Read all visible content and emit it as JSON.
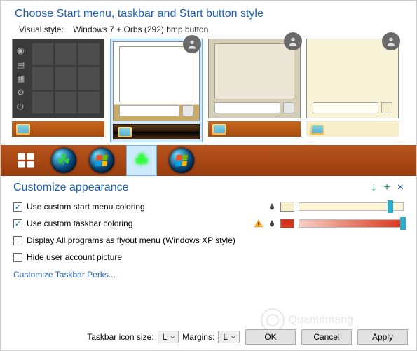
{
  "header": {
    "title": "Choose Start menu, taskbar and Start button style"
  },
  "visualStyle": {
    "label": "Visual style:",
    "value": "Windows 7 + Orbs (292).bmp button"
  },
  "thumbs": [
    {
      "name": "win8-style",
      "selected": false,
      "hasAvatar": false
    },
    {
      "name": "win7-style",
      "selected": true,
      "hasAvatar": true
    },
    {
      "name": "flatglass-style",
      "selected": false,
      "hasAvatar": true
    },
    {
      "name": "plain-light-style",
      "selected": false,
      "hasAvatar": true
    }
  ],
  "orbs": [
    {
      "name": "flat-windows-orb",
      "selected": false
    },
    {
      "name": "clover-blue-orb",
      "selected": false
    },
    {
      "name": "win7-default-orb",
      "selected": false
    },
    {
      "name": "neon-clover-orb",
      "selected": true
    },
    {
      "name": "win-flag-glass-orb",
      "selected": false
    }
  ],
  "customize": {
    "title": "Customize appearance",
    "actions": {
      "download": "↓",
      "add": "+",
      "close": "×"
    },
    "options": {
      "useStartMenuColoring": {
        "label": "Use custom start menu coloring",
        "checked": true,
        "swatch": "#f8f0c9",
        "sliderPos": 0.85
      },
      "useTaskbarColoring": {
        "label": "Use custom taskbar coloring",
        "checked": true,
        "swatch": "#d7351a",
        "sliderPos": 0.98,
        "warning": true
      },
      "flyoutMenu": {
        "label": "Display All programs as flyout menu (Windows XP style)",
        "checked": false
      },
      "hideUserPic": {
        "label": "Hide user account picture",
        "checked": false
      }
    },
    "link": "Customize Taskbar Perks..."
  },
  "footer": {
    "iconSizeLabel": "Taskbar icon size:",
    "iconSizeValue": "L",
    "marginsLabel": "Margins:",
    "marginsValue": "L",
    "ok": "OK",
    "cancel": "Cancel",
    "apply": "Apply"
  },
  "watermark": "Quantrimang"
}
